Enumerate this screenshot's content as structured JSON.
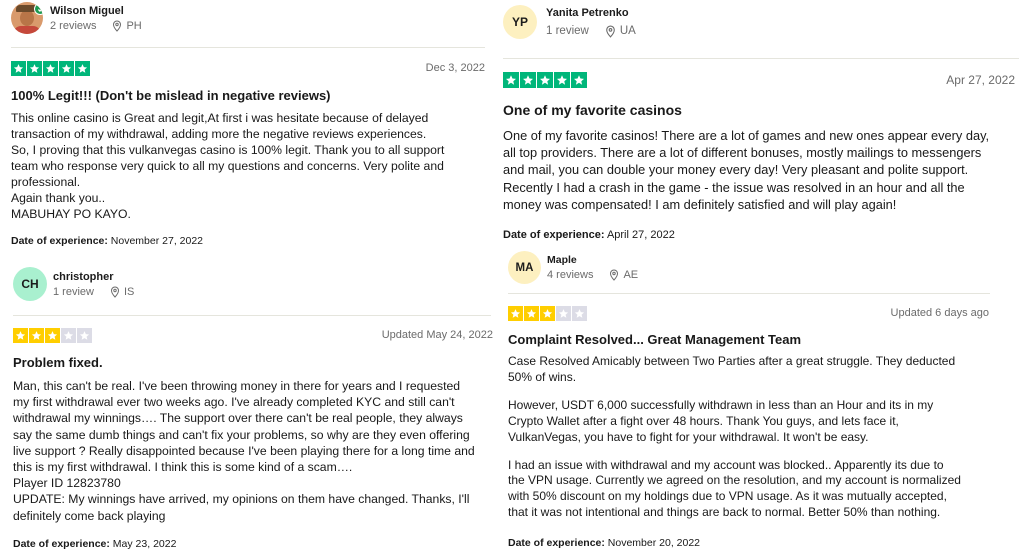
{
  "colors": {
    "star_green": "#00b67a",
    "star_grey": "#dcdce6",
    "star_three": "#ffce00",
    "avatar_ch": "#a9f0cf",
    "avatar_yp": "#fdf0c0",
    "avatar_ma": "#fdf0c0",
    "verified_badge": "#1e9a51"
  },
  "icons": {
    "location": "pin-icon",
    "rating_star": "star-icon",
    "verified": "check-icon"
  },
  "reviews": [
    {
      "reviewer": {
        "name": "Wilson Miguel",
        "reviews": "2 reviews",
        "country": "PH",
        "avatar": "photo"
      },
      "rating": 5,
      "date": "Dec 3, 2022",
      "title": "100% Legit!!! (Don't be mislead in negative reviews)",
      "lines": [
        "This online casino is Great and legit,At first i was hesitate because of delayed",
        "transaction of my withdrawal, adding more the negative reviews experiences.",
        "So, I proving that this vulkanvegas casino is 100% legit. Thank you to all support",
        "team who response very quick to all my questions and concerns. Very polite and",
        "professional.",
        "Again thank you..",
        "MABUHAY PO KAYO."
      ],
      "experience_label": "Date of experience:",
      "experience_date": "November 27, 2022"
    },
    {
      "reviewer": {
        "name": "christopher",
        "reviews": "1 review",
        "country": "IS",
        "initials": "CH"
      },
      "rating": 3,
      "date": "Updated May 24, 2022",
      "title": "Problem fixed.",
      "lines": [
        "Man, this can't be real. I've been throwing money in there for years and I requested",
        "my first withdrawal ever two weeks ago. I've already completed KYC and still can't",
        "withdrawal my winnings…. The support over there can't be real people, they always",
        "say the same dumb things and can't fix your problems, so why are they even offering",
        "live support ? Really disappointed because I've been playing there for a long time and",
        "this is my first withdrawal. I think this is some kind of a scam….",
        "Player ID 12823780",
        "UPDATE: My winnings have arrived, my opinions on them have changed. Thanks, I'll",
        "definitely come back playing"
      ],
      "experience_label": "Date of experience:",
      "experience_date": "May 23, 2022"
    },
    {
      "reviewer": {
        "name": "Yanita Petrenko",
        "reviews": "1 review",
        "country": "UA",
        "initials": "YP"
      },
      "rating": 5,
      "date": "Apr 27, 2022",
      "title": "One of my favorite casinos",
      "lines": [
        "One of my favorite casinos! There are a lot of games and new ones appear every day,",
        "all top providers. There are a lot of different bonuses, mostly mailings to messengers",
        "and mail, you can double your money every day! Very pleasant and polite support.",
        "Recently I had a crash in the game - the issue was resolved in an hour and all the",
        "money was compensated! I am definitely satisfied and will play again!"
      ],
      "experience_label": "Date of experience:",
      "experience_date": "April 27, 2022"
    },
    {
      "reviewer": {
        "name": "Maple",
        "reviews": "4 reviews",
        "country": "AE",
        "initials": "MA"
      },
      "rating": 3,
      "date": "Updated 6 days ago",
      "title": "Complaint Resolved... Great Management Team",
      "lines": [
        "Case Resolved Amicably between Two Parties after a great struggle. They deducted",
        "50% of wins.",
        "",
        "However, USDT 6,000 successfully withdrawn in less than an Hour and its in my",
        "Crypto Wallet after a fight over 48 hours. Thank You guys, and lets face it,",
        "VulkanVegas, you have to fight for your withdrawal. It won't be easy.",
        "",
        "I had an issue with withdrawal and my account was blocked.. Apparently its due to",
        "the VPN usage. Currently we agreed on the resolution, and my account is normalized",
        "with 50% discount on my holdings due to VPN usage. As it was mutually accepted,",
        "that it was not intentional and things are back to normal. Better 50% than nothing."
      ],
      "experience_label": "Date of experience:",
      "experience_date": "November 20, 2022"
    }
  ]
}
